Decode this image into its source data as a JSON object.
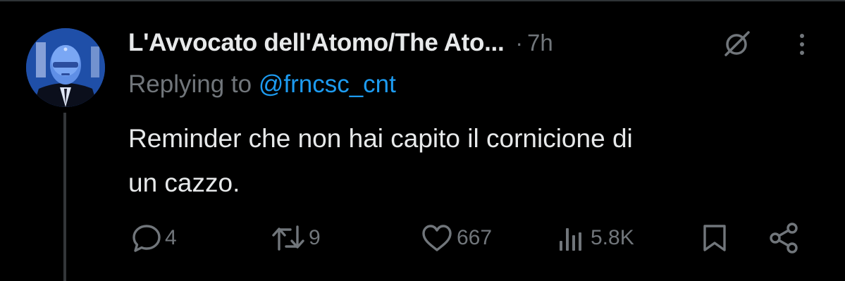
{
  "tweet": {
    "display_name": "L'Avvocato dell'Atomo/The Ato...",
    "separator": "·",
    "time": "7h",
    "reply_prefix": "Replying to",
    "reply_handle": "@frncsc_cnt",
    "text_lines": [
      "Reminder che non hai capito il cornicione di",
      "un cazzo."
    ]
  },
  "actions": {
    "replies": "4",
    "reposts": "9",
    "likes": "667",
    "views": "5.8K"
  },
  "icons": {
    "header": [
      "grok-icon",
      "more-icon"
    ],
    "actions": [
      "reply-icon",
      "repost-icon",
      "like-icon",
      "views-icon",
      "bookmark-icon",
      "share-icon"
    ]
  },
  "colors": {
    "background": "#000000",
    "text_primary": "#e7e9ea",
    "text_secondary": "#71767b",
    "link": "#1d9bf0",
    "divider": "#2f3336"
  }
}
